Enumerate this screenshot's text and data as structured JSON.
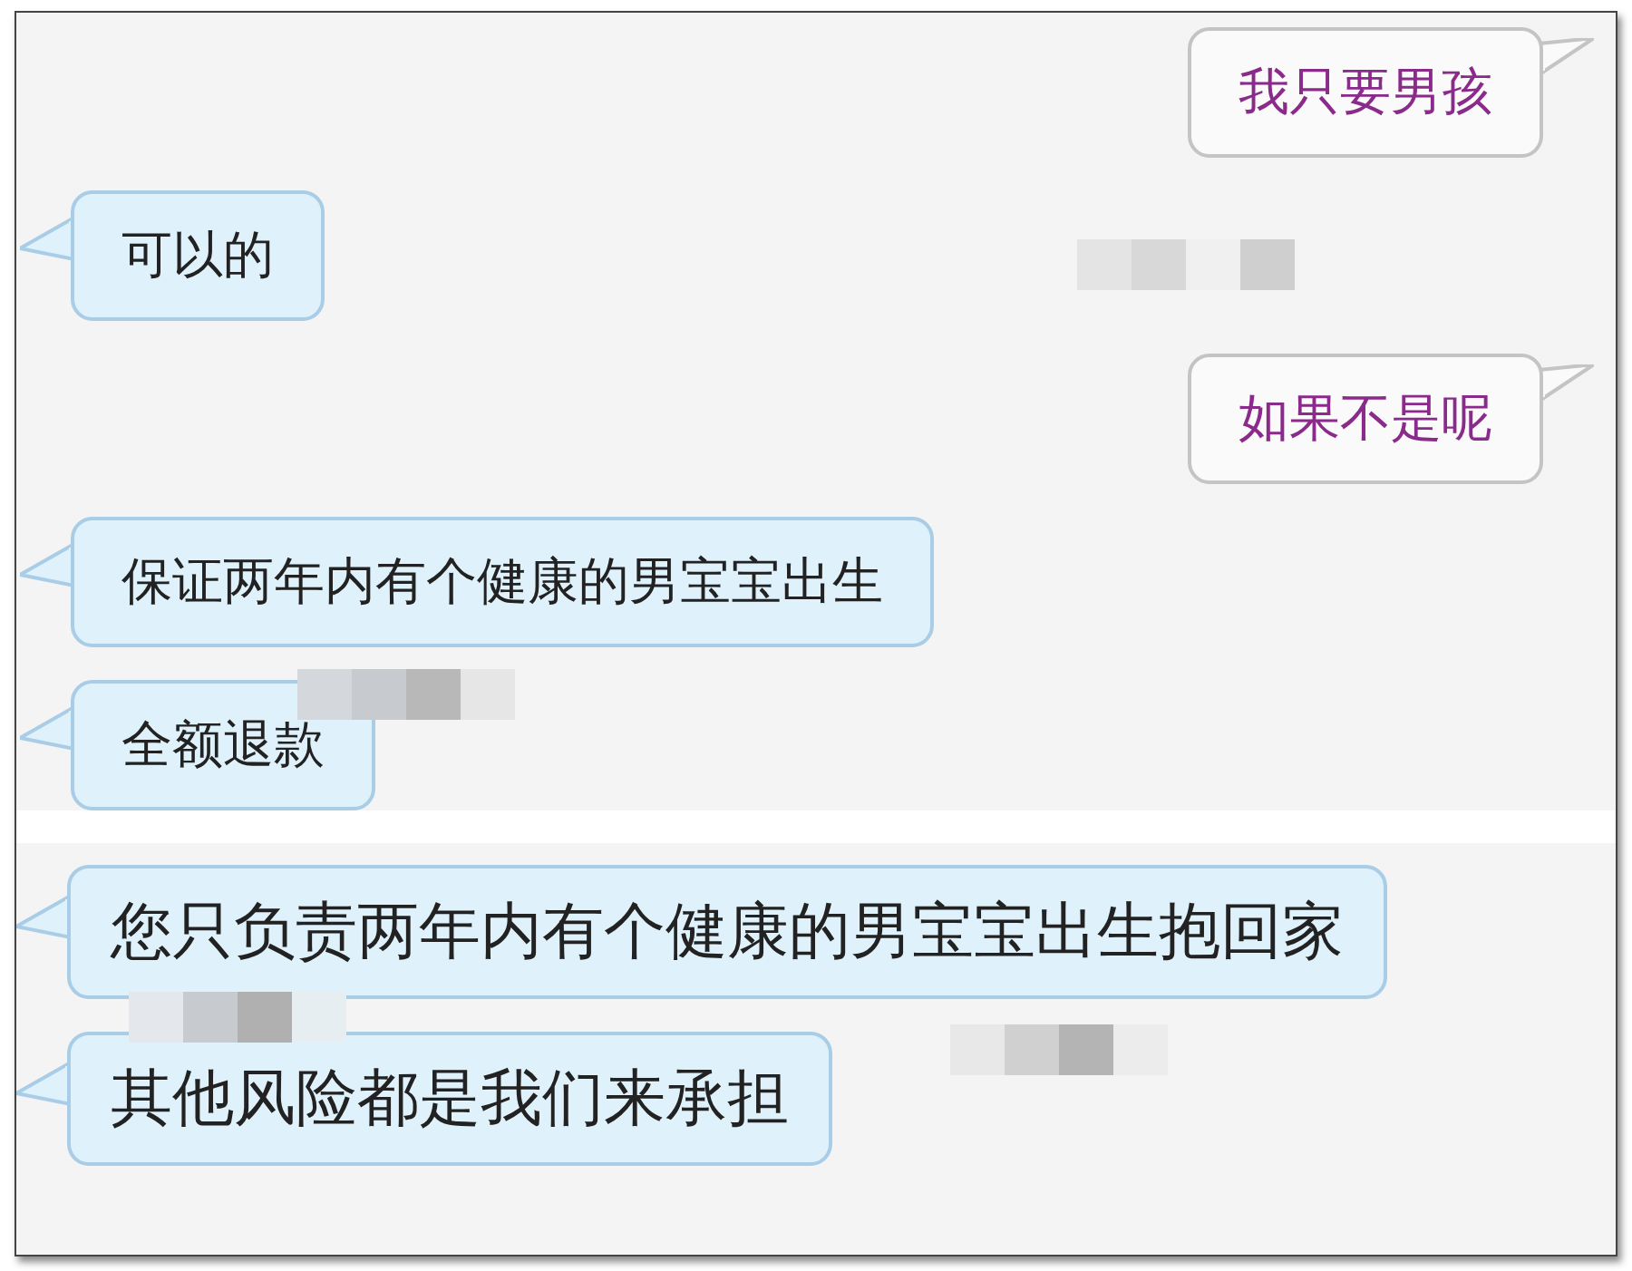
{
  "sections": [
    {
      "messages": [
        {
          "kind": "sent",
          "text": "我只要男孩"
        },
        {
          "kind": "received",
          "text": "可以的"
        },
        {
          "kind": "sent",
          "text": "如果不是呢"
        },
        {
          "kind": "received",
          "text": "保证两年内有个健康的男宝宝出生"
        },
        {
          "kind": "received",
          "text": "全额退款"
        }
      ]
    },
    {
      "messages": [
        {
          "kind": "received",
          "text": "您只负责两年内有个健康的男宝宝出生抱回家"
        },
        {
          "kind": "received",
          "text": "其他风险都是我们来承担"
        }
      ]
    }
  ]
}
